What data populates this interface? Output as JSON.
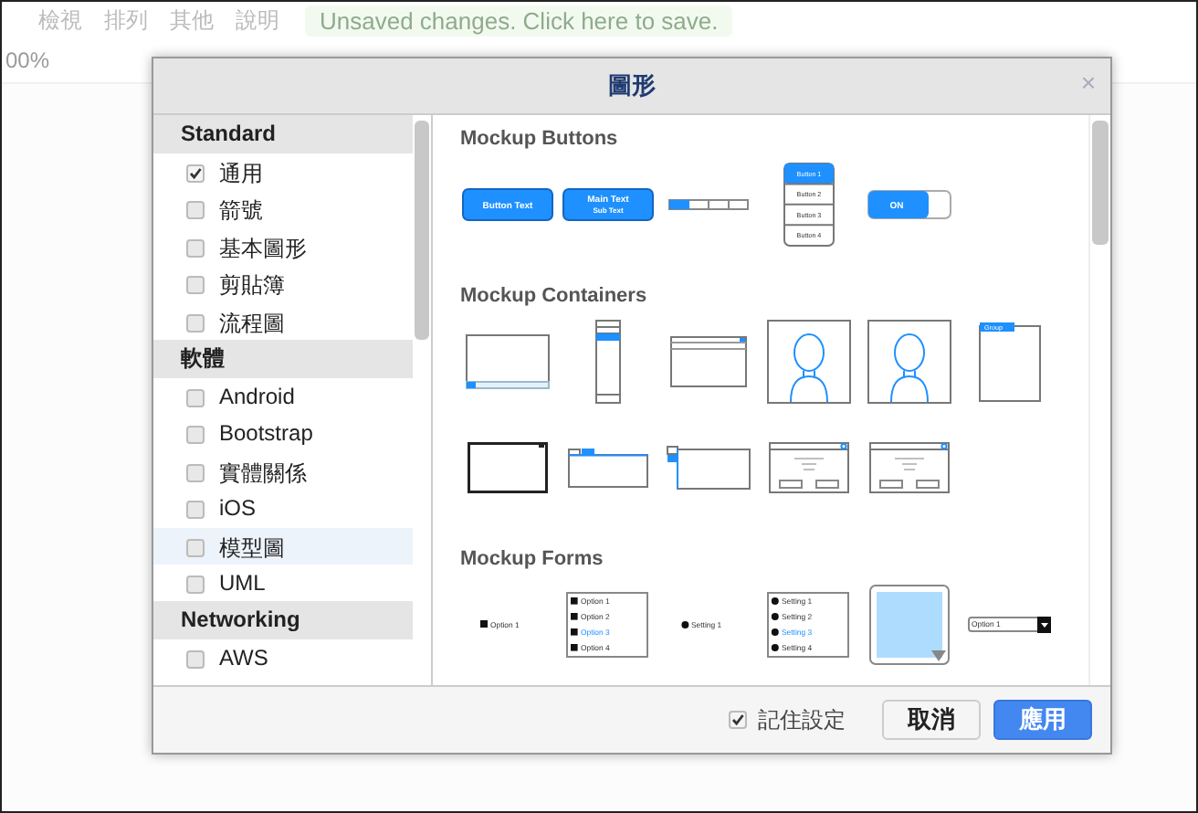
{
  "app": {
    "menu": [
      "檢視",
      "排列",
      "其他",
      "說明"
    ],
    "banner": "Unsaved changes. Click here to save.",
    "zoom": "00%"
  },
  "dialog": {
    "title": "圖形",
    "close": "×",
    "sidebar": [
      {
        "heading": "Standard",
        "items": [
          {
            "label": "通用",
            "checked": true,
            "selected": false
          },
          {
            "label": "箭號",
            "checked": false,
            "selected": false
          },
          {
            "label": "基本圖形",
            "checked": false,
            "selected": false
          },
          {
            "label": "剪貼簿",
            "checked": false,
            "selected": false
          },
          {
            "label": "流程圖",
            "checked": false,
            "selected": false
          }
        ]
      },
      {
        "heading": "軟體",
        "items": [
          {
            "label": "Android",
            "checked": false,
            "selected": false
          },
          {
            "label": "Bootstrap",
            "checked": false,
            "selected": false
          },
          {
            "label": "實體關係",
            "checked": false,
            "selected": false
          },
          {
            "label": "iOS",
            "checked": false,
            "selected": false
          },
          {
            "label": "模型圖",
            "checked": false,
            "selected": true
          },
          {
            "label": "UML",
            "checked": false,
            "selected": false
          }
        ]
      },
      {
        "heading": "Networking",
        "items": [
          {
            "label": "AWS",
            "checked": false,
            "selected": false
          }
        ]
      }
    ],
    "sections": [
      {
        "title": "Mockup Buttons",
        "rows": [
          [
            {
              "kind": "button",
              "labels": [
                {
                  "text": "Button Text"
                }
              ]
            },
            {
              "kind": "button",
              "labels": [
                {
                  "text": "Main Text"
                },
                {
                  "text": "Sub Text"
                }
              ]
            },
            {
              "kind": "segmented"
            },
            {
              "kind": "buttonstack",
              "labels": [
                {
                  "text": "Button 1",
                  "selected": true
                },
                {
                  "text": "Button 2",
                  "selected": false
                },
                {
                  "text": "Button 3",
                  "selected": false
                },
                {
                  "text": "Button 4",
                  "selected": false
                }
              ]
            },
            {
              "kind": "toggle",
              "labels": [
                {
                  "text": "ON",
                  "selected": true
                }
              ]
            }
          ]
        ]
      },
      {
        "title": "Mockup Containers",
        "rows": [
          [
            {
              "kind": "window"
            },
            {
              "kind": "accordion"
            },
            {
              "kind": "browser"
            },
            {
              "kind": "person"
            },
            {
              "kind": "person"
            },
            {
              "kind": "group",
              "labels": [
                {
                  "text": "Group",
                  "selected": true
                }
              ]
            }
          ],
          [
            {
              "kind": "frame"
            },
            {
              "kind": "tabs"
            },
            {
              "kind": "sidetabs"
            },
            {
              "kind": "dialog"
            },
            {
              "kind": "dialog"
            }
          ]
        ]
      },
      {
        "title": "Mockup Forms",
        "rows": [
          [
            {
              "kind": "checkbox",
              "labels": [
                {
                  "text": "Option 1"
                }
              ]
            },
            {
              "kind": "checklist",
              "labels": [
                {
                  "text": "Option 1",
                  "selected": false
                },
                {
                  "text": "Option 2",
                  "selected": false
                },
                {
                  "text": "Option 3",
                  "selected": true
                },
                {
                  "text": "Option 4",
                  "selected": false
                }
              ]
            },
            {
              "kind": "radio",
              "labels": [
                {
                  "text": "Setting 1"
                }
              ]
            },
            {
              "kind": "radiolist",
              "labels": [
                {
                  "text": "Setting 1",
                  "selected": false
                },
                {
                  "text": "Setting 2",
                  "selected": false
                },
                {
                  "text": "Setting 3",
                  "selected": true
                },
                {
                  "text": "Setting 4",
                  "selected": false
                }
              ]
            },
            {
              "kind": "colorpicker"
            },
            {
              "kind": "combo",
              "labels": [
                {
                  "text": "Option 1"
                }
              ]
            }
          ]
        ]
      }
    ],
    "footer": {
      "remember": {
        "label": "記住設定",
        "checked": true
      },
      "cancel": "取消",
      "apply": "應用"
    }
  }
}
